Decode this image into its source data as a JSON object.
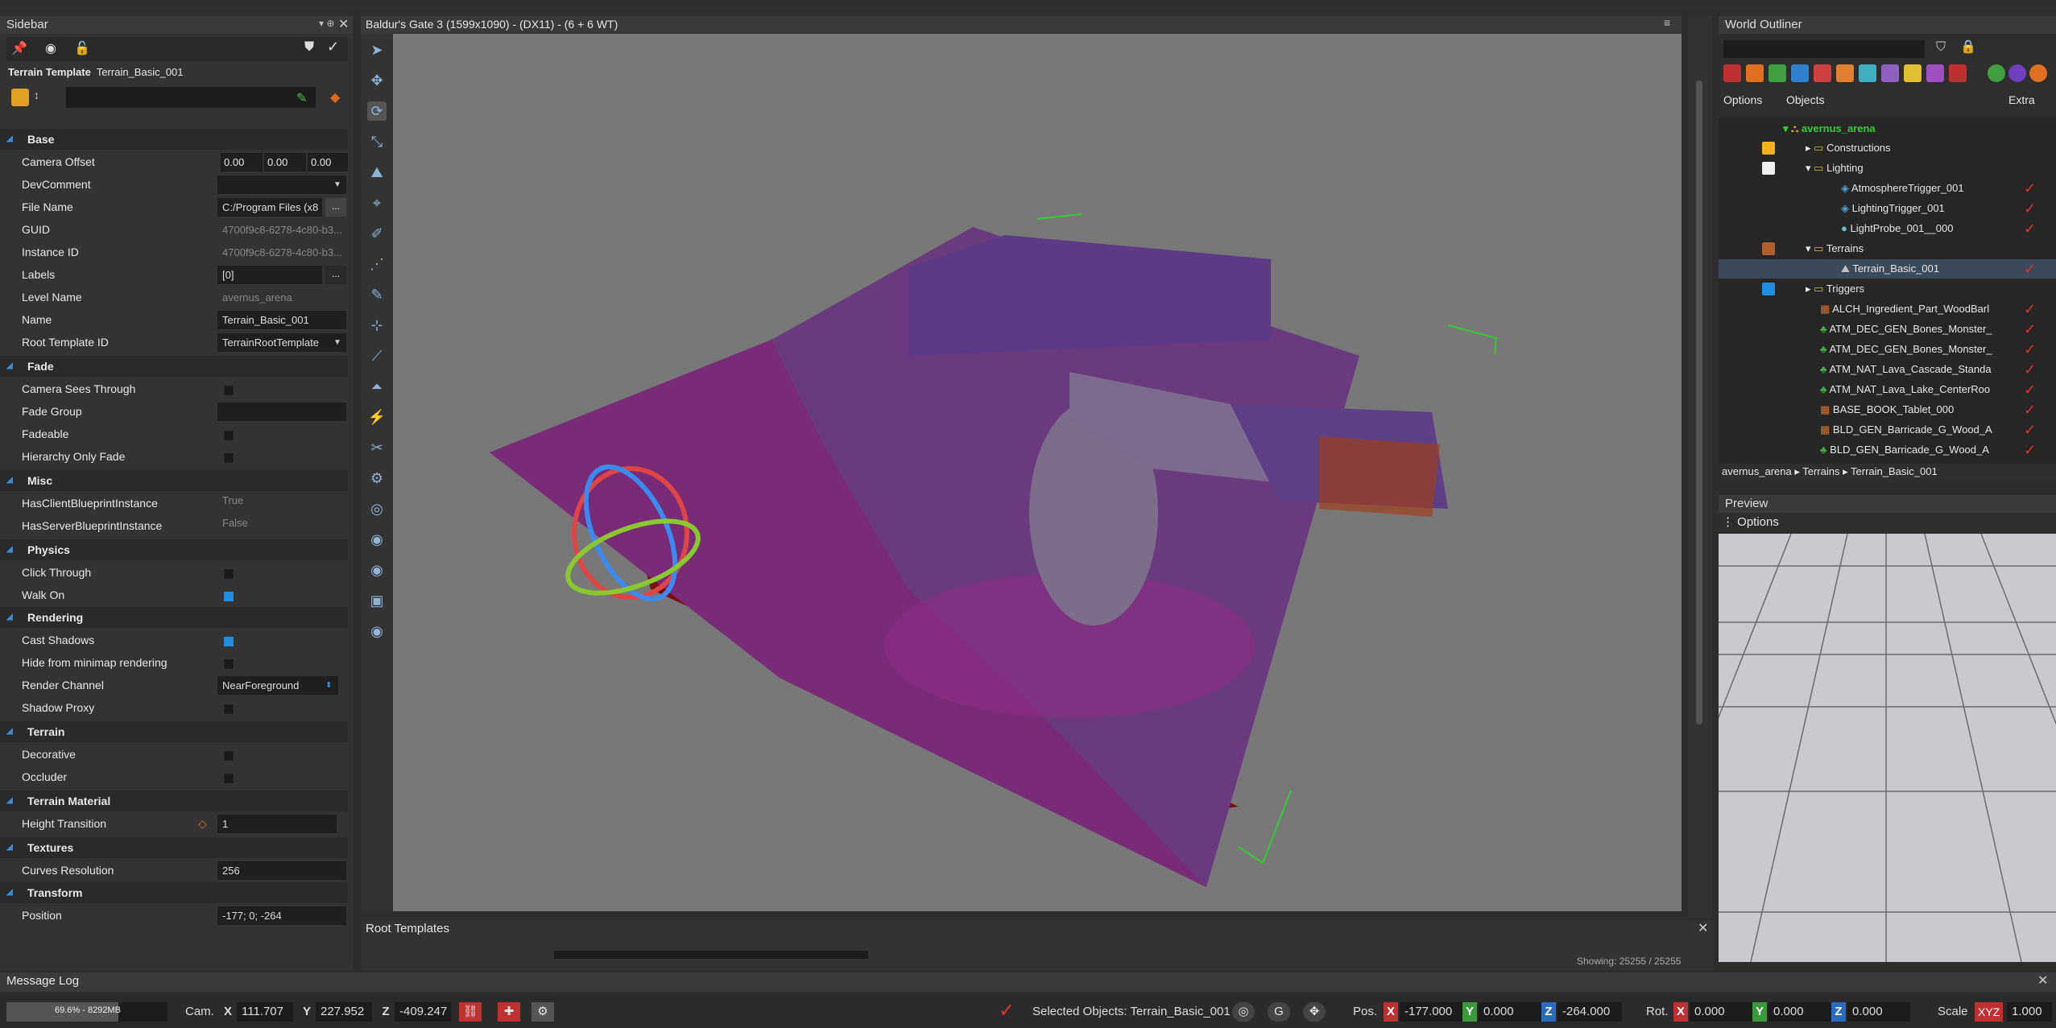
{
  "sidebar": {
    "title": "Sidebar",
    "template_label": "Terrain Template",
    "template_name": "Terrain_Basic_001",
    "sections": {
      "base": "Base",
      "fade": "Fade",
      "misc": "Misc",
      "physics": "Physics",
      "rendering": "Rendering",
      "terrain": "Terrain",
      "terrain_material": "Terrain Material",
      "textures": "Textures",
      "transform": "Transform"
    },
    "props": {
      "camera_offset": {
        "label": "Camera Offset",
        "x": "0.00",
        "y": "0.00",
        "z": "0.00"
      },
      "dev_comment": {
        "label": "DevComment",
        "value": ""
      },
      "file_name": {
        "label": "File Name",
        "value": "C:/Program Files (x8"
      },
      "guid": {
        "label": "GUID",
        "value": "4700f9c8-6278-4c80-b3..."
      },
      "instance_id": {
        "label": "Instance ID",
        "value": "4700f9c8-6278-4c80-b3..."
      },
      "labels": {
        "label": "Labels",
        "value": "[0]"
      },
      "level_name": {
        "label": "Level Name",
        "value": "avernus_arena"
      },
      "name": {
        "label": "Name",
        "value": "Terrain_Basic_001"
      },
      "root_template_id": {
        "label": "Root Template ID",
        "value": "TerrainRootTemplate"
      },
      "camera_sees_through": {
        "label": "Camera Sees Through"
      },
      "fade_group": {
        "label": "Fade Group"
      },
      "fadeable": {
        "label": "Fadeable"
      },
      "hierarchy_only_fade": {
        "label": "Hierarchy Only Fade"
      },
      "has_client_bp": {
        "label": "HasClientBlueprintInstance",
        "value": "True"
      },
      "has_server_bp": {
        "label": "HasServerBlueprintInstance",
        "value": "False"
      },
      "click_through": {
        "label": "Click Through"
      },
      "walk_on": {
        "label": "Walk On"
      },
      "cast_shadows": {
        "label": "Cast Shadows"
      },
      "hide_minimap": {
        "label": "Hide from minimap rendering"
      },
      "render_channel": {
        "label": "Render Channel",
        "value": "NearForeground"
      },
      "shadow_proxy": {
        "label": "Shadow Proxy"
      },
      "decorative": {
        "label": "Decorative"
      },
      "occluder": {
        "label": "Occluder"
      },
      "height_transition": {
        "label": "Height Transition",
        "value": "1"
      },
      "curves_resolution": {
        "label": "Curves Resolution",
        "value": "256"
      },
      "position": {
        "label": "Position",
        "value": "-177; 0; -264"
      }
    }
  },
  "viewport": {
    "title": "Baldur's Gate 3 (1599x1090) - (DX11) - (6 + 6 WT)"
  },
  "outliner": {
    "title": "World Outliner",
    "options_label": "Options",
    "objects_label": "Objects",
    "extra_label": "Extra",
    "root": "avernus_arena",
    "items": [
      "Constructions",
      "Lighting",
      "AtmosphereTrigger_001",
      "LightingTrigger_001",
      "LightProbe_001__000",
      "Terrains",
      "Terrain_Basic_001",
      "Triggers",
      "ALCH_Ingredient_Part_WoodBarl",
      "ATM_DEC_GEN_Bones_Monster_",
      "ATM_DEC_GEN_Bones_Monster_",
      "ATM_NAT_Lava_Cascade_Standa",
      "ATM_NAT_Lava_Lake_CenterRoo",
      "BASE_BOOK_Tablet_000",
      "BLD_GEN_Barricade_G_Wood_A",
      "BLD_GEN_Barricade_G_Wood_A"
    ],
    "breadcrumb": [
      "avernus_arena",
      "Terrains",
      "Terrain_Basic_001"
    ]
  },
  "preview": {
    "title": "Preview",
    "options_label": "Options"
  },
  "root_templates": {
    "title": "Root Templates",
    "showing": "Showing: 25255 / 25255"
  },
  "message_log": {
    "title": "Message Log"
  },
  "status": {
    "memory": "69.6% - 8292MB",
    "memory_fraction": 0.696,
    "cam_label": "Cam.",
    "cam_x": "111.707",
    "cam_y": "227.952",
    "cam_z": "-409.247",
    "selected": "Selected Objects: Terrain_Basic_001",
    "pos_label": "Pos.",
    "pos_x": "-177.000",
    "pos_y": "0.000",
    "pos_z": "-264.000",
    "rot_label": "Rot.",
    "rot_x": "0.000",
    "rot_y": "0.000",
    "rot_z": "0.000",
    "scale_label": "Scale",
    "scale_axes": "XYZ",
    "scale": "1.000",
    "x": "X",
    "y": "Y",
    "z": "Z"
  },
  "colors": {
    "terrain_purple": "#6a3a7e",
    "lava_red": "#7a0e12",
    "accent_blue": "#1f8ee0",
    "check_red": "#e03030",
    "root_green": "#33cc33"
  }
}
